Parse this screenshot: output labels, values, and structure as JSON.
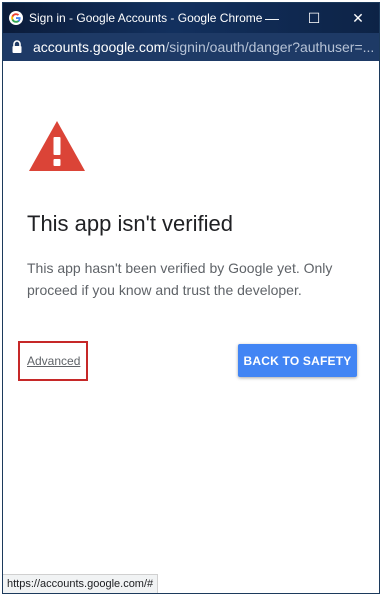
{
  "window": {
    "title": "Sign in - Google Accounts - Google Chrome",
    "minimize_glyph": "—",
    "maximize_glyph": "☐",
    "close_glyph": "✕"
  },
  "addressbar": {
    "host": "accounts.google.com",
    "path": "/signin/oauth/danger?authuser=..."
  },
  "page": {
    "heading": "This app isn't verified",
    "body": "This app hasn't been verified by Google yet. Only proceed if you know and trust the developer.",
    "advanced_label": "Advanced",
    "back_label": "BACK TO SAFETY"
  },
  "status_url": "https://accounts.google.com/#",
  "colors": {
    "warning": "#db4437",
    "primary_button": "#4285f4",
    "highlight_box": "#c62828"
  }
}
